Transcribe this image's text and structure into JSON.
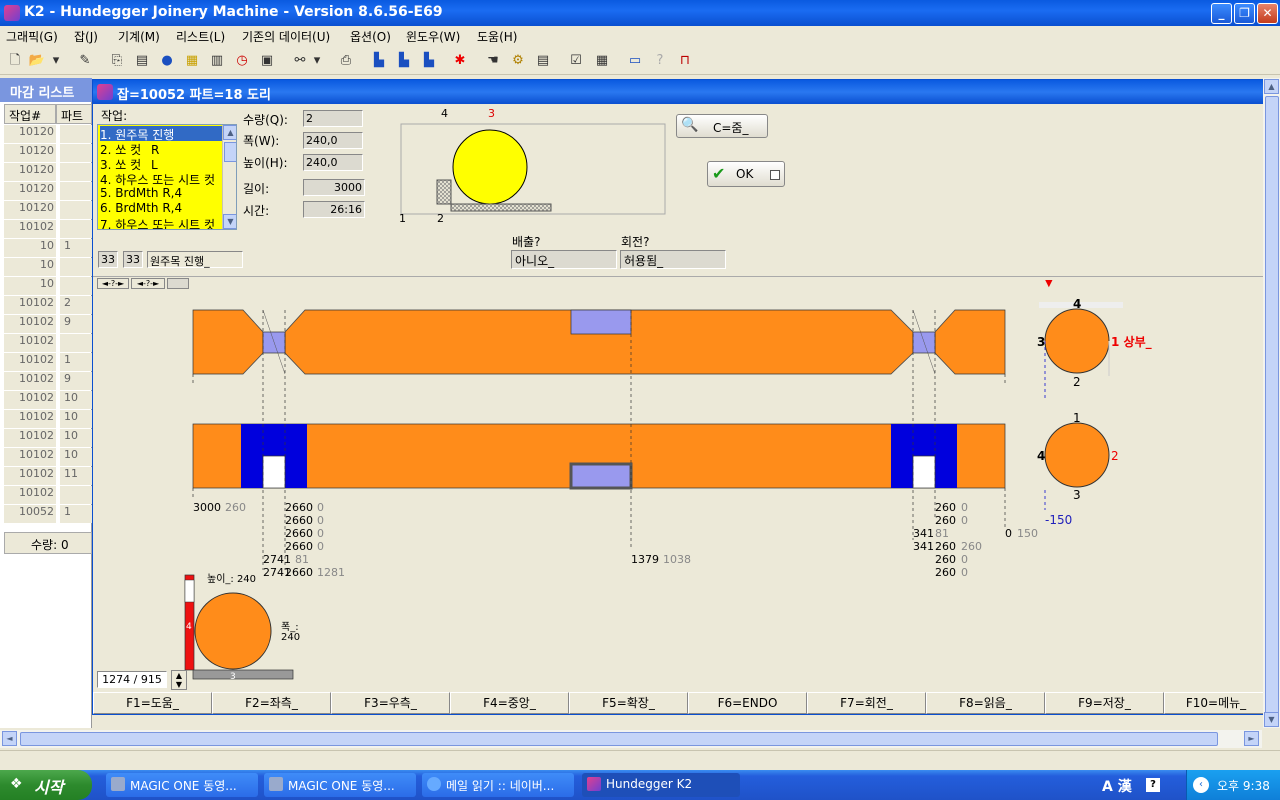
{
  "window": {
    "title": "K2 - Hundegger Joinery Machine - Version 8.6.56-E69"
  },
  "menu": [
    "그래픽(G)",
    "잡(J)",
    "기계(M)",
    "리스트(L)",
    "기존의 데이터(U)",
    "옵션(O)",
    "윈도우(W)",
    "도움(H)"
  ],
  "bglist": {
    "title": "마감 리스트",
    "col1": "작업#",
    "col2": "파트#",
    "rows": [
      {
        "a": "10120",
        "b": ""
      },
      {
        "a": "10120",
        "b": ""
      },
      {
        "a": "10120",
        "b": ""
      },
      {
        "a": "10120",
        "b": ""
      },
      {
        "a": "10120",
        "b": ""
      },
      {
        "a": "10102",
        "b": ""
      },
      {
        "a": "10",
        "b": "1"
      },
      {
        "a": "10",
        "b": ""
      },
      {
        "a": "10",
        "b": ""
      },
      {
        "a": "10102",
        "b": "2"
      },
      {
        "a": "10102",
        "b": "9"
      },
      {
        "a": "10102",
        "b": ""
      },
      {
        "a": "10102",
        "b": "1"
      },
      {
        "a": "10102",
        "b": "9"
      },
      {
        "a": "10102",
        "b": "10"
      },
      {
        "a": "10102",
        "b": "10"
      },
      {
        "a": "10102",
        "b": "10"
      },
      {
        "a": "10102",
        "b": "10"
      },
      {
        "a": "10102",
        "b": "11"
      },
      {
        "a": "10102",
        "b": ""
      },
      {
        "a": "10052",
        "b": "1"
      }
    ],
    "qty": "수량: 0"
  },
  "dialog": {
    "title": "잡=10052  파트=18 도리",
    "task_label": "작업:",
    "tasks": [
      "1. 원주목 진행_",
      "2. 쏘 컷_ R",
      "3. 쏘 컷_ L",
      "4. 하우스 또는 시트 컷",
      "5. BrdMth R,4",
      "6. BrdMth R,4",
      "7. 하우스 또는 시트 컷"
    ],
    "qty_label": "수량(Q):",
    "qty": "2",
    "width_label": "폭(W):",
    "width": "240,0",
    "height_label": "높이(H):",
    "height": "240,0",
    "length_label": "길이:",
    "length": "3000",
    "time_label": "시간:",
    "time": "26:16",
    "small1": "33",
    "small2": "33",
    "small_text": "원주목 진행_",
    "zoom_label": "C=줌_",
    "ok_label": "OK",
    "eject_label": "배출?",
    "eject_value": "아니오_",
    "rotate_label": "회전?",
    "rotate_value": "허용됨_",
    "preview_top_labels": [
      "4",
      "3"
    ],
    "preview_bottom_labels": [
      "1",
      "2"
    ],
    "nav": [
      "◄-?-►",
      "◄-?-►"
    ],
    "side_top": {
      "top": "4",
      "left": "3",
      "right": "1 상부_",
      "bottom": "2"
    },
    "side_bottom": {
      "top": "1",
      "left": "4",
      "right": "2",
      "bottom": "3",
      "offset": "-150"
    },
    "dims": {
      "left1": "3000",
      "left1b": "260",
      "c1": [
        "2660",
        "2660",
        "2660",
        "2660"
      ],
      "c1b": [
        "0",
        "0",
        "0",
        "0"
      ],
      "d1": "2741",
      "d1b": "81",
      "d2": "2741",
      "d2b": "2660",
      "d2c": "1281",
      "mid": "1379",
      "midb": "1038",
      "r1": "341",
      "r1b": "81",
      "r2": "341",
      "r2b": "260",
      "r2c": "260",
      "rr": [
        "260",
        "260",
        "260",
        "260",
        "260"
      ],
      "rrb": [
        "0",
        "0",
        "0",
        "0",
        "0"
      ],
      "end": "0",
      "endb": "150"
    },
    "xsec": {
      "height_label": "높이_: 240",
      "width_label": "폭_:",
      "width_val": "240",
      "side3": "3",
      "side4": "4"
    },
    "coord": "1274 / 915",
    "fkeys": [
      "F1=도움_",
      "F2=좌측_",
      "F3=우측_",
      "F4=중앙_",
      "F5=확장_",
      "F6=ENDO",
      "F7=회전_",
      "F8=읽음_",
      "F9=저장_",
      "F10=메뉴_"
    ]
  },
  "taskbar": {
    "start": "시작",
    "tasks": [
      "MAGIC ONE 동영...",
      "MAGIC ONE 동영...",
      "메일 읽기 :: 네이버...",
      "Hundegger K2"
    ],
    "tray_ime": "A 漢",
    "clock": "오후 9:38"
  },
  "colors": {
    "beam": "#ff8c1a",
    "pocket": "#9999ee",
    "cut": "#0000dd",
    "xsec": "#ffff00"
  }
}
